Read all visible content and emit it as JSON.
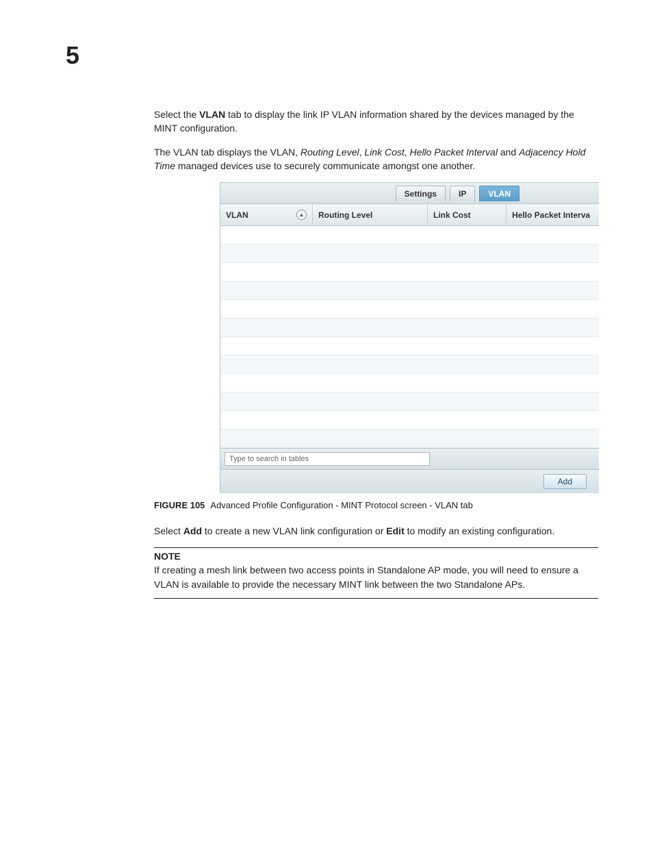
{
  "chapter_number": "5",
  "para1": {
    "pre": "Select the ",
    "bold": "VLAN",
    "post": " tab to display the link IP VLAN information shared by the devices managed by the MINT configuration."
  },
  "para2": {
    "pre": "The VLAN tab displays the VLAN, ",
    "i1": "Routing Level",
    "s1": ", ",
    "i2": "Link Cost",
    "s2": ", ",
    "i3": "Hello Packet Interval",
    "s3": " and ",
    "i4": "Adjacency Hold Time",
    "post": " managed devices use to securely communicate amongst one another."
  },
  "tabs": {
    "settings": "Settings",
    "ip": "IP",
    "vlan": "VLAN"
  },
  "headers": {
    "vlan": "VLAN",
    "routing_level": "Routing Level",
    "link_cost": "Link Cost",
    "hello_packet_interval": "Hello Packet Interva",
    "sort_glyph": "▲"
  },
  "search_placeholder": "Type to search in tables",
  "add_label": "Add",
  "caption": {
    "label": "FIGURE 105",
    "text": "Advanced Profile Configuration - MINT Protocol screen - VLAN tab"
  },
  "para3": {
    "pre": "Select ",
    "b1": "Add",
    "mid": " to create a new VLAN link configuration or ",
    "b2": "Edit",
    "post": " to modify an existing configuration."
  },
  "note": {
    "heading": "NOTE",
    "text": "If creating a mesh link between two access points in Standalone AP mode, you will need to ensure a VLAN is available to provide the necessary MINT link between the two Standalone APs."
  }
}
